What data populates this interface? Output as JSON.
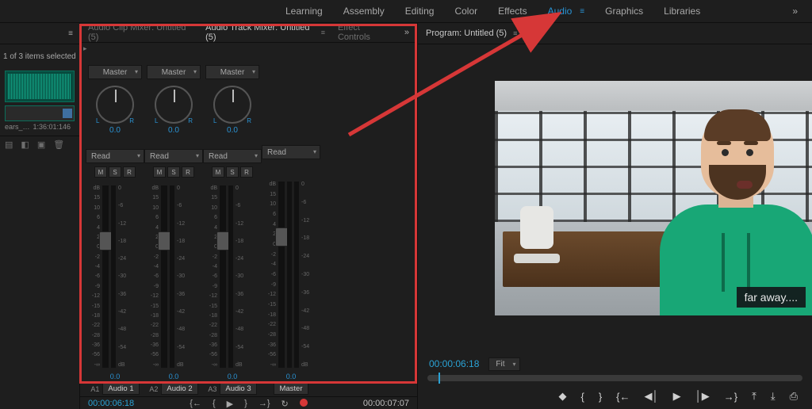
{
  "workspaces": {
    "items": [
      "Learning",
      "Assembly",
      "Editing",
      "Color",
      "Effects",
      "Audio",
      "Graphics",
      "Libraries"
    ],
    "active": "Audio",
    "more": "»"
  },
  "project": {
    "selection_text": "1 of 3 items selected",
    "clip_duration_a": "ears_…",
    "clip_duration_b": "1:36:01:146",
    "toolbar_icons": [
      "list-ic",
      "free-ic",
      "new-ic",
      "trash-ic"
    ]
  },
  "mixer": {
    "tabs": {
      "clip": "Audio Clip Mixer: Untitled (5)",
      "track": "Audio Track Mixer: Untitled (5)",
      "fx": "Effect Controls",
      "active": "track",
      "more": "»"
    },
    "pan": {
      "left_label": "L",
      "right_label": "R",
      "value": "0.0"
    },
    "auto_mode": "Read",
    "msr": {
      "m": "M",
      "s": "S",
      "r": "R"
    },
    "scale_left": [
      "dB",
      "15",
      "10",
      "6",
      "4",
      "2",
      "0",
      "-2",
      "-4",
      "-6",
      "-9",
      "-12",
      "-15",
      "-18",
      "-22",
      "-28",
      "-36",
      "-56",
      "-∞"
    ],
    "scale_right": [
      "0",
      "-6",
      "-12",
      "-18",
      "-24",
      "-30",
      "-36",
      "-42",
      "-48",
      "-54",
      "dB"
    ],
    "tracks": [
      {
        "id": "A1",
        "name": "Audio 1",
        "output": "Master",
        "gain": "0.0",
        "has_pan": true,
        "has_msr": true
      },
      {
        "id": "A2",
        "name": "Audio 2",
        "output": "Master",
        "gain": "0.0",
        "has_pan": true,
        "has_msr": true
      },
      {
        "id": "A3",
        "name": "Audio 3",
        "output": "Master",
        "gain": "0.0",
        "has_pan": true,
        "has_msr": true
      },
      {
        "id": "",
        "name": "Master",
        "output": "",
        "gain": "0.0",
        "has_pan": false,
        "has_msr": false
      }
    ],
    "transport": {
      "tc_left": "00:00:06:18",
      "tc_right": "00:00:07:07"
    }
  },
  "program": {
    "tab": "Program: Untitled (5)",
    "caption": "far away....",
    "tc": "00:00:06:18",
    "fit_label": "Fit"
  },
  "controls": {
    "go_in": "{←",
    "mark_in": "{",
    "step_back": "◀│",
    "play": "▶",
    "step_fwd": "│▶",
    "mark_out": "}",
    "go_out": "→}",
    "loop": "↻",
    "record": "●",
    "add_marker": "◆",
    "camera": "⎙",
    "prog_in": "{←",
    "prog_step_back": "◀│",
    "prog_play": "▶",
    "prog_step_fwd": "│▶",
    "prog_out": "→}",
    "lift": "⤒",
    "extract": "⤓",
    "export": "⎙"
  }
}
